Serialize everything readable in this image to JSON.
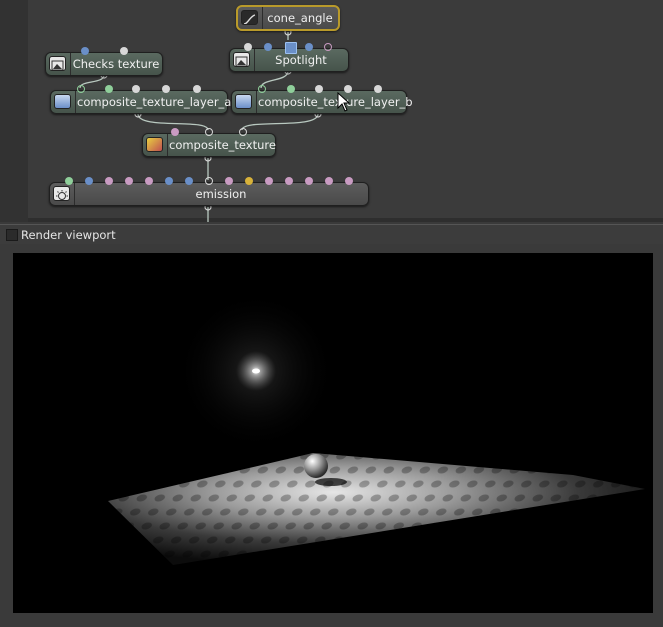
{
  "nodes": {
    "cone_angle": "cone_angle",
    "checks_texture": "Checks texture",
    "spotlight": "Spotlight",
    "layer_a": "composite_texture_layer_a",
    "layer_b": "composite_texture_layer_b",
    "composite_texture": "composite_texture",
    "emission": "emission"
  },
  "viewport": {
    "title": "Render viewport"
  },
  "colors": {
    "port_white": "#d8d8d8",
    "port_green": "#8fcf9a",
    "port_blue": "#6a8fc8",
    "port_pink": "#c99bc2",
    "port_yellow": "#d8b23a",
    "selection": "#b99a2a"
  },
  "icons": {
    "cone_angle": "curve-icon",
    "checks_texture": "image-icon",
    "spotlight": "image-icon",
    "layer_a": "layer-icon",
    "layer_b": "layer-icon",
    "composite_texture": "gradient-icon",
    "emission": "light-bulb-icon"
  }
}
